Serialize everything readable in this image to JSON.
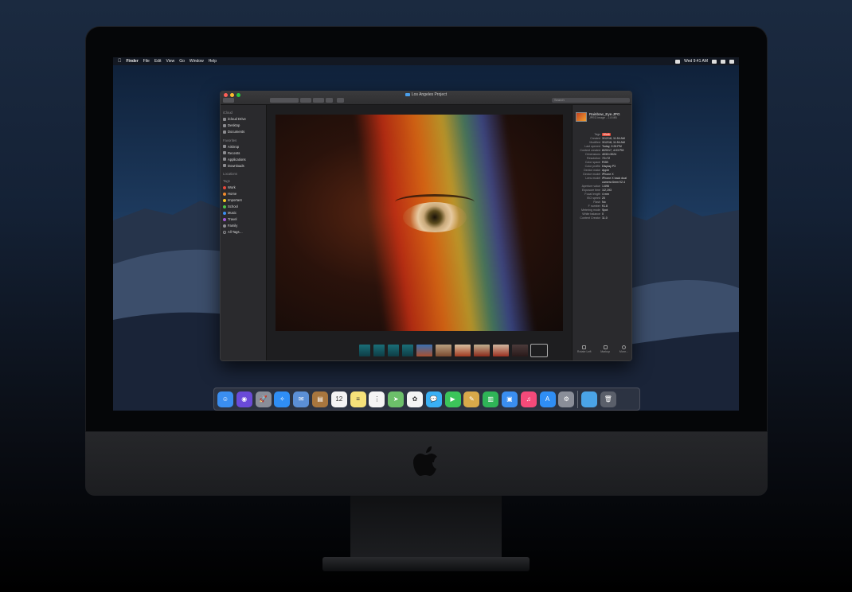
{
  "menubar": {
    "app": "Finder",
    "items": [
      "File",
      "Edit",
      "View",
      "Go",
      "Window",
      "Help"
    ],
    "clock": "Wed 9:41 AM"
  },
  "window": {
    "title": "Los Angeles Project",
    "search_placeholder": "Search"
  },
  "sidebar": {
    "sections": [
      {
        "header": "iCloud",
        "items": [
          {
            "label": "iCloud Drive",
            "icon": "cloud-icon"
          },
          {
            "label": "Desktop",
            "icon": "desktop-icon"
          },
          {
            "label": "Documents",
            "icon": "document-icon"
          }
        ]
      },
      {
        "header": "Favorites",
        "items": [
          {
            "label": "AirDrop",
            "icon": "airdrop-icon"
          },
          {
            "label": "Recents",
            "icon": "clock-icon"
          },
          {
            "label": "Applications",
            "icon": "applications-icon"
          },
          {
            "label": "Downloads",
            "icon": "download-icon"
          }
        ]
      },
      {
        "header": "Locations",
        "items": []
      }
    ],
    "tags_header": "Tags",
    "tags": [
      {
        "label": "Work",
        "color": "#e5483a"
      },
      {
        "label": "Home",
        "color": "#f08a2c"
      },
      {
        "label": "Important",
        "color": "#f4c623"
      },
      {
        "label": "School",
        "color": "#4cc34a"
      },
      {
        "label": "Music",
        "color": "#3a8ef0"
      },
      {
        "label": "Travel",
        "color": "#a25ad6"
      },
      {
        "label": "Family",
        "color": "#8e8e93"
      },
      {
        "label": "All Tags…",
        "color": ""
      }
    ]
  },
  "inspector": {
    "file_name": "Rainbow_Eye.JPG",
    "file_kind": "JPEG image - 2.8 MB",
    "rows": [
      {
        "k": "Tags",
        "v": "Work",
        "tag": true
      },
      {
        "k": "Created",
        "v": "3/12/18, 11:54 AM"
      },
      {
        "k": "Modified",
        "v": "3/12/18, 11:54 AM"
      },
      {
        "k": "Last opened",
        "v": "Today, 2:26 PM"
      },
      {
        "k": "Content created",
        "v": "8/20/17, 4:03 PM"
      },
      {
        "k": "Dimensions",
        "v": "4032×3024"
      },
      {
        "k": "Resolution",
        "v": "72×72"
      },
      {
        "k": "Color space",
        "v": "RGB"
      },
      {
        "k": "Color profile",
        "v": "Display P3"
      },
      {
        "k": "Device make",
        "v": "Apple"
      },
      {
        "k": "Device model",
        "v": "iPhone X"
      },
      {
        "k": "Lens model",
        "v": "iPhone X back dual"
      },
      {
        "k": "",
        "v": "camera 6mm f/2.4"
      },
      {
        "k": "Aperture value",
        "v": "1.696"
      },
      {
        "k": "Exposure time",
        "v": "1/2,193"
      },
      {
        "k": "Focal length",
        "v": "4 mm"
      },
      {
        "k": "ISO speed",
        "v": "20"
      },
      {
        "k": "Flash",
        "v": "No"
      },
      {
        "k": "F number",
        "v": "f/1.8"
      },
      {
        "k": "Metering mode",
        "v": "Spot"
      },
      {
        "k": "White balance",
        "v": "0"
      },
      {
        "k": "Content Creator",
        "v": "11.0"
      }
    ],
    "actions": [
      "Rotate Left",
      "Markup",
      "More..."
    ]
  },
  "dock": {
    "apps": [
      {
        "name": "finder-icon",
        "color": "#3a8ef0",
        "glyph": "☺"
      },
      {
        "name": "siri-icon",
        "color": "#6a4ad8",
        "glyph": "◉"
      },
      {
        "name": "launchpad-icon",
        "color": "#8a8e99",
        "glyph": "🚀"
      },
      {
        "name": "safari-icon",
        "color": "#2f8ef5",
        "glyph": "✧"
      },
      {
        "name": "photo-browser-icon",
        "color": "#5b8fd6",
        "glyph": "✉"
      },
      {
        "name": "contacts-icon",
        "color": "#a8763e",
        "glyph": "▤"
      },
      {
        "name": "calendar-icon",
        "color": "#f4f4f4",
        "glyph": "12"
      },
      {
        "name": "notes-icon",
        "color": "#f6e27a",
        "glyph": "≡"
      },
      {
        "name": "reminders-icon",
        "color": "#f4f4f4",
        "glyph": "⋮"
      },
      {
        "name": "maps-icon",
        "color": "#6cbf6a",
        "glyph": "➤"
      },
      {
        "name": "photos-icon",
        "color": "#f4f4f4",
        "glyph": "✿"
      },
      {
        "name": "messages-icon",
        "color": "#3ab0f5",
        "glyph": "💬"
      },
      {
        "name": "facetime-icon",
        "color": "#3cc45a",
        "glyph": "▶"
      },
      {
        "name": "preview-icon",
        "color": "#d8a94a",
        "glyph": "✎"
      },
      {
        "name": "numbers-icon",
        "color": "#2fb457",
        "glyph": "▥"
      },
      {
        "name": "keynote-icon",
        "color": "#3a8ef0",
        "glyph": "▣"
      },
      {
        "name": "itunes-icon",
        "color": "#f44a7a",
        "glyph": "♫"
      },
      {
        "name": "app-store-icon",
        "color": "#2f8ef5",
        "glyph": "A"
      },
      {
        "name": "system-preferences-icon",
        "color": "#8a8e99",
        "glyph": "⚙"
      },
      {
        "name": "folder-icon",
        "color": "#4aa3e6",
        "glyph": ""
      },
      {
        "name": "trash-icon",
        "color": "#5a5f6a",
        "glyph": "🗑"
      }
    ]
  }
}
